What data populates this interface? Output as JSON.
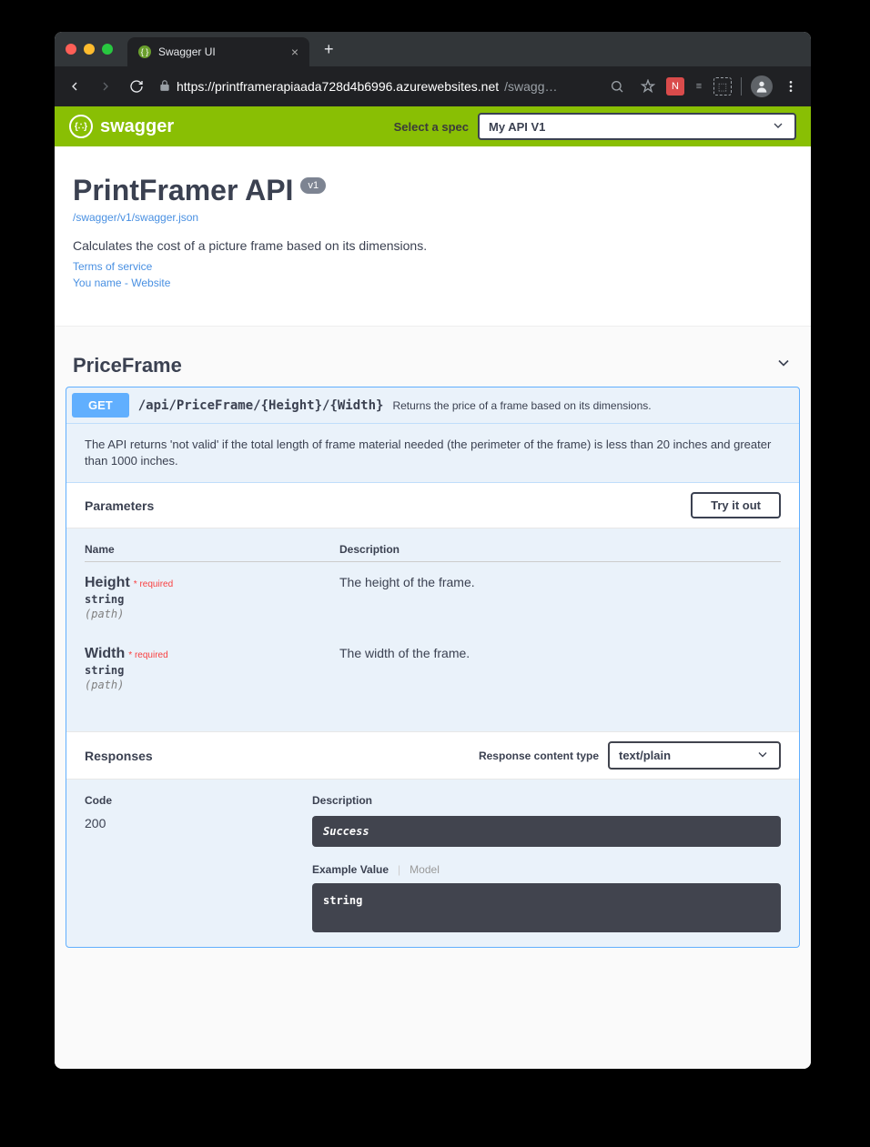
{
  "browser": {
    "tab_title": "Swagger UI",
    "url_host": "https://printframerapiaada728d4b6996.azurewebsites.net",
    "url_path": "/swagg…"
  },
  "swagger_header": {
    "brand": "swagger",
    "select_label": "Select a spec",
    "selected_spec": "My API V1"
  },
  "info": {
    "title": "PrintFramer API",
    "version": "v1",
    "spec_url": "/swagger/v1/swagger.json",
    "description": "Calculates the cost of a picture frame based on its dimensions.",
    "terms": "Terms of service",
    "contact": "You name - Website"
  },
  "tag": {
    "name": "PriceFrame"
  },
  "operation": {
    "method": "GET",
    "path": "/api/PriceFrame/{Height}/{Width}",
    "summary": "Returns the price of a frame based on its dimensions.",
    "long_description": "The API returns 'not valid' if the total length of frame material needed (the perimeter of the frame) is less than 20 inches and greater than 1000 inches.",
    "params_heading": "Parameters",
    "try_button": "Try it out",
    "col_name": "Name",
    "col_desc": "Description",
    "required_label": "required",
    "params": [
      {
        "name": "Height",
        "type": "string",
        "location": "(path)",
        "description": "The height of the frame."
      },
      {
        "name": "Width",
        "type": "string",
        "location": "(path)",
        "description": "The width of the frame."
      }
    ],
    "responses_heading": "Responses",
    "content_type_label": "Response content type",
    "content_type_value": "text/plain",
    "resp_col_code": "Code",
    "resp_col_desc": "Description",
    "responses": [
      {
        "code": "200",
        "message": "Success",
        "example_tab": "Example Value",
        "model_tab": "Model",
        "example_body": "string"
      }
    ]
  }
}
